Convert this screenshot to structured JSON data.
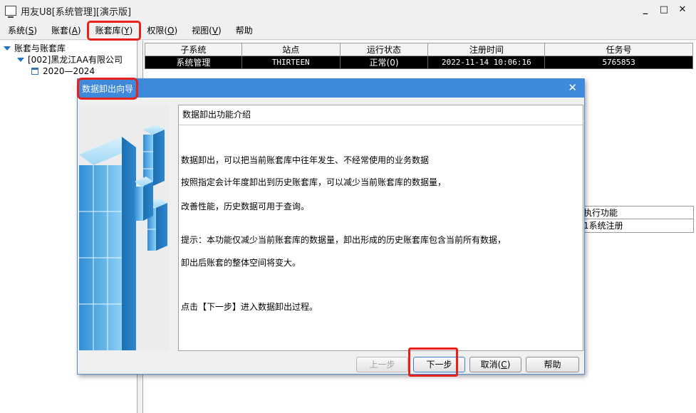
{
  "window": {
    "title": "用友U8[系统管理][演示版]",
    "controls": {
      "minimize": "_",
      "maximize": "□",
      "close": "✕"
    }
  },
  "menu": {
    "items": [
      {
        "label": "系统(",
        "key": "S",
        "tail": ")"
      },
      {
        "label": "账套(",
        "key": "A",
        "tail": ")"
      },
      {
        "label": "账套库(",
        "key": "Y",
        "tail": ")"
      },
      {
        "label": "权限(",
        "key": "O",
        "tail": ")"
      },
      {
        "label": "视图(",
        "key": "V",
        "tail": ")"
      },
      {
        "label": "帮助",
        "key": "",
        "tail": ""
      }
    ]
  },
  "tree": {
    "root": "账套与账套库",
    "company": "[002]黑龙江AA有限公司",
    "year": "2020—2024"
  },
  "grid": {
    "headers": [
      "子系统",
      "站点",
      "运行状态",
      "注册时间",
      "任务号"
    ],
    "rows": [
      [
        "系统管理",
        "THIRTEEN",
        "正常(0)",
        "2022-11-14 10:06:16",
        "5765853"
      ]
    ]
  },
  "side_list": {
    "items": [
      "执行功能",
      "1系统注册"
    ]
  },
  "dialog": {
    "title": "数据卸出向导",
    "close": "✕",
    "heading": "数据卸出功能介绍",
    "lines": [
      "数据卸出，可以把当前账套库中往年发生、不经常使用的业务数据",
      "按照指定会计年度卸出到历史账套库，可以减少当前账套库的数据量，",
      "改善性能，历史数据可用于查询。",
      "提示：本功能仅减少当前账套库的数据量，卸出形成的历史账套库包含当前所有数据，",
      "卸出后账套的整体空间将变大。",
      "点击【下一步】进入数据卸出过程。"
    ],
    "buttons": {
      "prev": "上一步",
      "next": "下一步",
      "cancel": "取消(",
      "cancel_key": "C",
      "cancel_tail": ")",
      "help": "帮助"
    }
  },
  "colors": {
    "dialog_title": "#3f89da",
    "highlight": "#e8211d",
    "tree_accent": "#1e70c8"
  }
}
